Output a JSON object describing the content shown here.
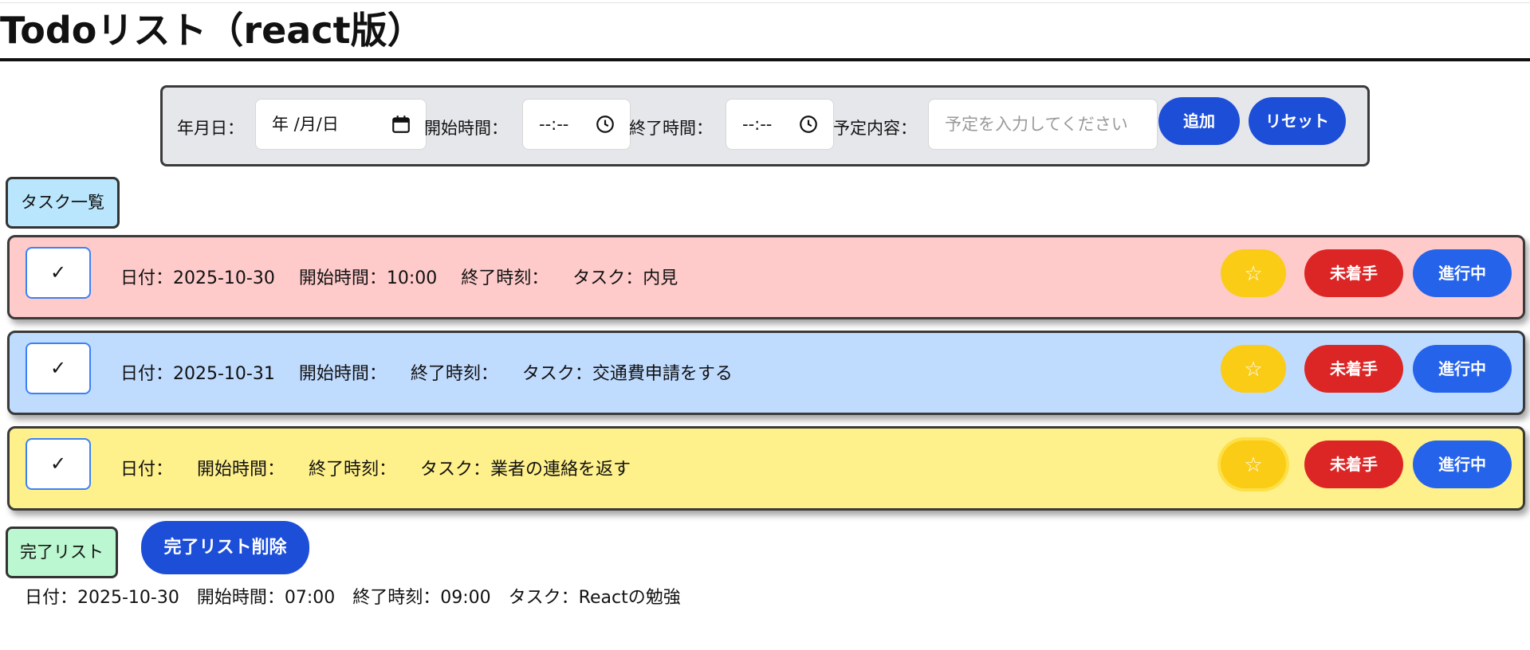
{
  "app": {
    "title": "Todoリスト（react版）"
  },
  "form": {
    "date_label": "年月日：",
    "date_placeholder": "年 /月/日",
    "start_label": "開始時間：",
    "start_placeholder": "--:--",
    "end_label": "終了時間：",
    "end_placeholder": "--:--",
    "content_label": "予定内容：",
    "content_placeholder": "予定を入力してください",
    "add_label": "追加",
    "reset_label": "リセット"
  },
  "task_section": {
    "label": "タスク一覧"
  },
  "tasks": [
    {
      "check": "✓",
      "date": "日付：2025-10-30",
      "start": "開始時間：10:00",
      "end": "終了時刻：",
      "task": "タスク：内見",
      "star": "☆",
      "todo": "未着手",
      "doing": "進行中",
      "color": "#fecaca"
    },
    {
      "check": "✓",
      "date": "日付：2025-10-31",
      "start": "開始時間：",
      "end": "終了時刻：",
      "task": "タスク：交通費申請をする",
      "star": "☆",
      "todo": "未着手",
      "doing": "進行中",
      "color": "#bfdbfe"
    },
    {
      "check": "✓",
      "date": "日付：",
      "start": "開始時間：",
      "end": "終了時刻：",
      "task": "タスク：業者の連絡を返す",
      "star": "☆",
      "todo": "未着手",
      "doing": "進行中",
      "color": "#fef08a"
    }
  ],
  "done_section": {
    "label": "完了リスト",
    "clear_label": "完了リスト削除",
    "items": [
      {
        "date": "日付：2025-10-30",
        "start": "開始時間：07:00",
        "end": "終了時刻：09:00",
        "task": "タスク：Reactの勉強"
      }
    ]
  }
}
